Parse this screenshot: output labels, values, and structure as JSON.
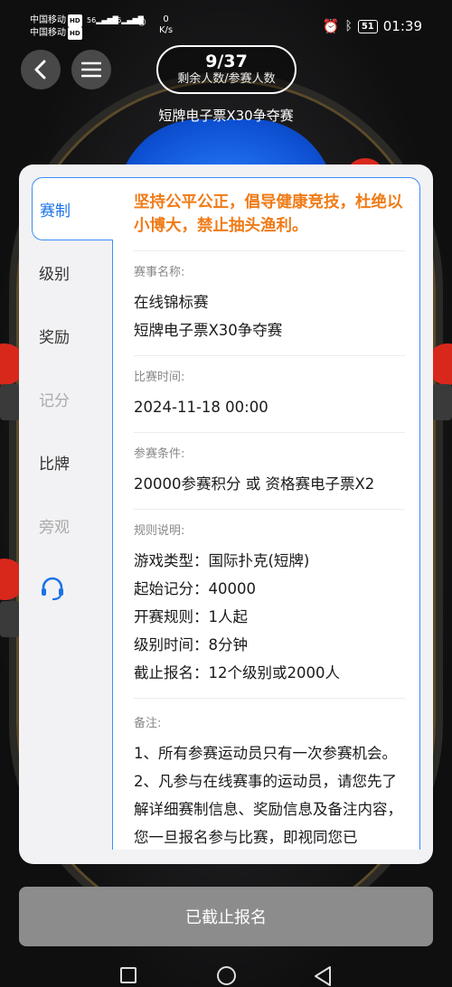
{
  "status_bar": {
    "carrier1": "中国移动",
    "carrier2": "中国移动",
    "hd": "HD",
    "signal1": "56",
    "signal2": "56",
    "speed_value": "0",
    "speed_unit": "K/s",
    "battery": "51",
    "time": "01:39"
  },
  "header": {
    "count": "9/37",
    "count_label": "剩余人数/参赛人数",
    "title": "短牌电子票X30争夺赛"
  },
  "tabs": [
    {
      "label": "赛制",
      "active": true
    },
    {
      "label": "级别"
    },
    {
      "label": "奖励"
    },
    {
      "label": "记分"
    },
    {
      "label": "比牌"
    },
    {
      "label": "旁观"
    }
  ],
  "panel": {
    "slogan": "坚持公平公正，倡导健康竞技，杜绝以小博大，禁止抽头渔利。",
    "name_label": "赛事名称:",
    "name_line1": "在线锦标赛",
    "name_line2": "短牌电子票X30争夺赛",
    "time_label": "比赛时间:",
    "time_value": "2024-11-18 00:00",
    "cond_label": "参赛条件:",
    "cond_value": "20000参赛积分 或 资格赛电子票X2",
    "rules_label": "规则说明:",
    "rules": [
      "游戏类型：国际扑克(短牌)",
      "起始记分：40000",
      "开赛规则：1人起",
      "级别时间：8分钟",
      "截止报名：12个级别或2000人"
    ],
    "notes_label": "备注:",
    "notes": [
      "1、所有参赛运动员只有一次参赛机会。",
      "2、凡参与在线赛事的运动员，请您先了解详细赛制信息、奖励信息及备注内容，您一旦报名参与比赛，即视同您已"
    ]
  },
  "bottom_button": "已截止报名",
  "colors": {
    "accent": "#1a73e8",
    "slogan": "#f07b17",
    "button_disabled": "#8c8c8c"
  }
}
